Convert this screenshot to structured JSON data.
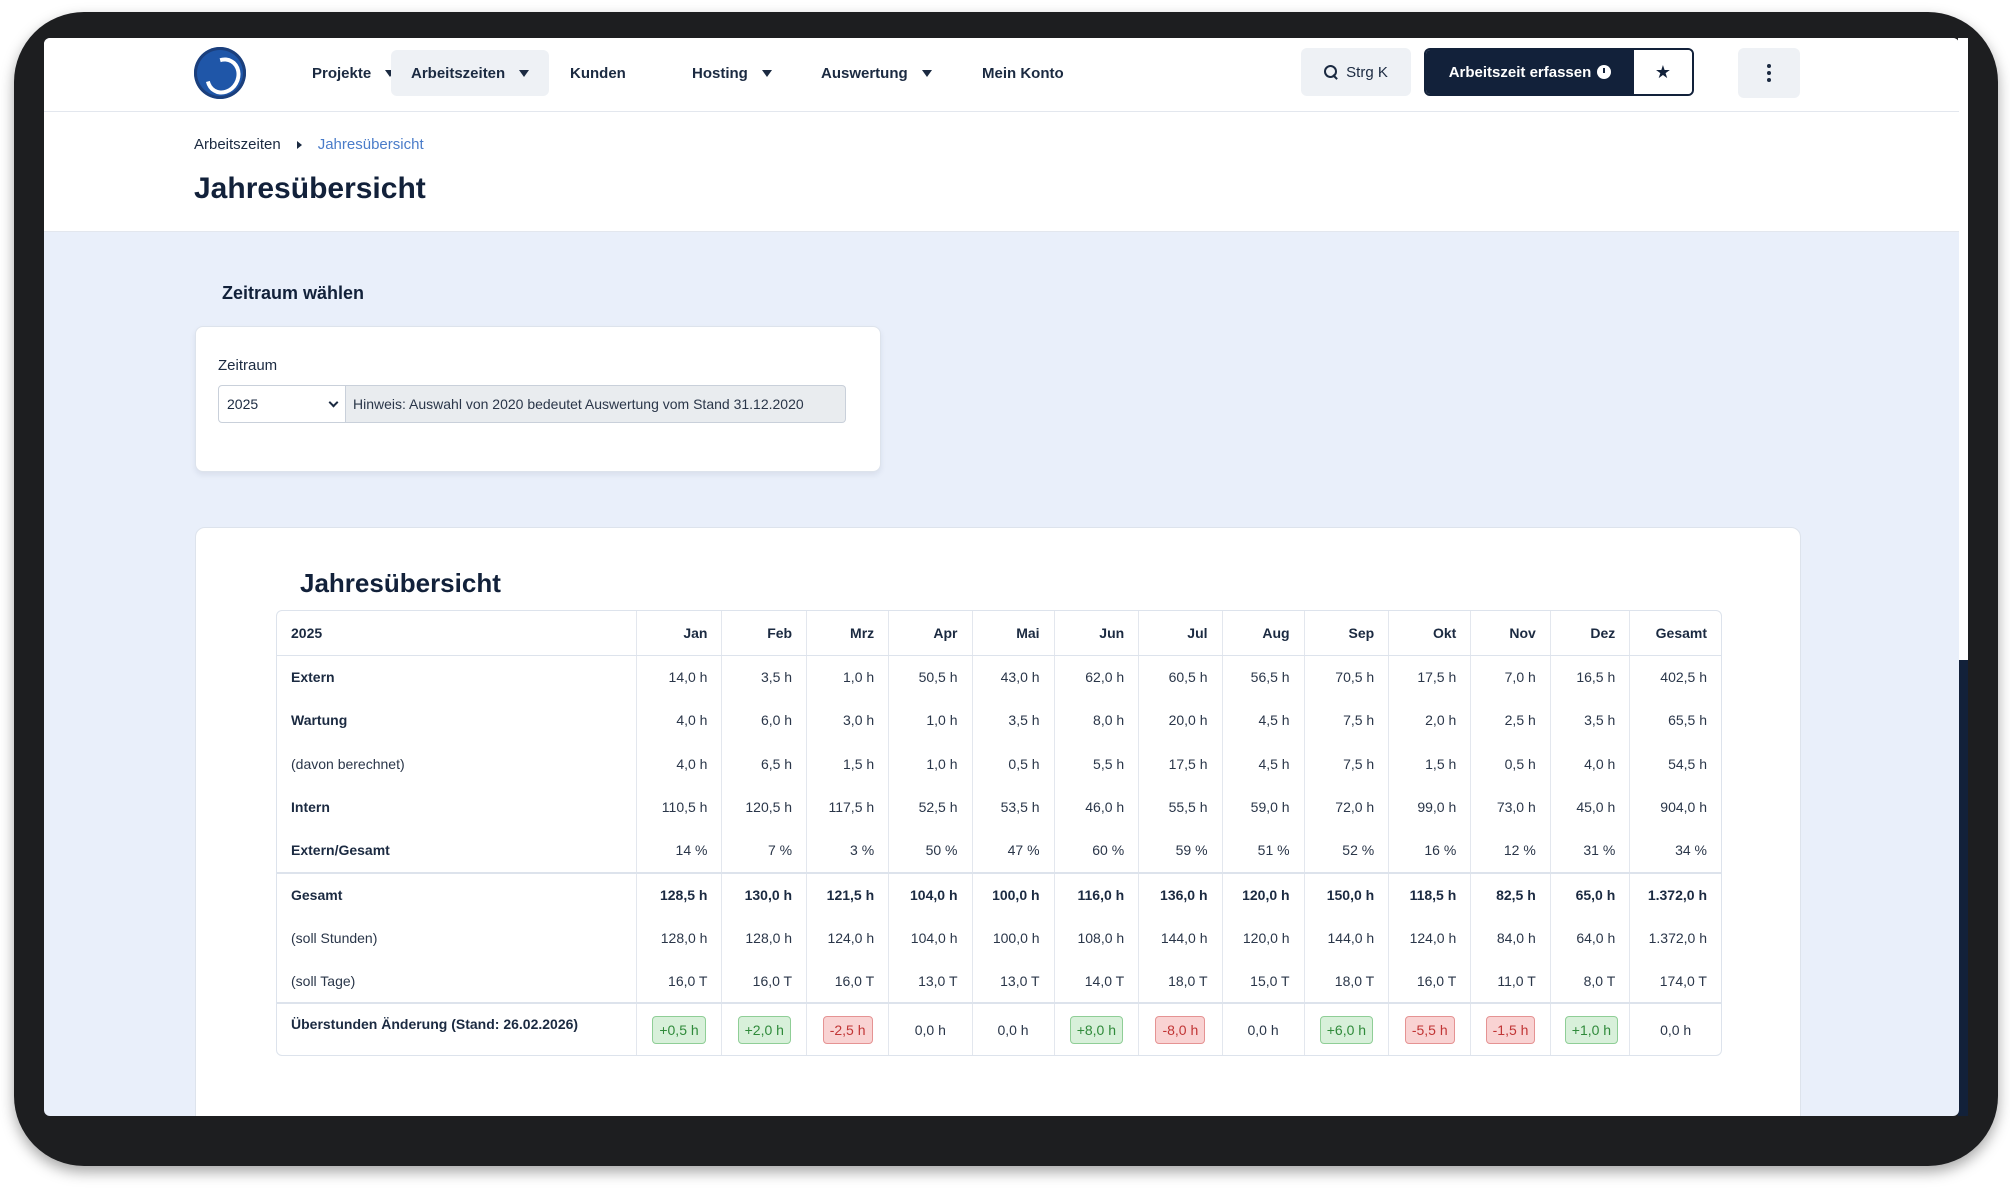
{
  "nav": {
    "items": [
      {
        "label": "Projekte",
        "has_caret": true
      },
      {
        "label": "Arbeitszeiten",
        "has_caret": true,
        "active": true
      },
      {
        "label": "Kunden",
        "has_caret": false
      },
      {
        "label": "Hosting",
        "has_caret": true
      },
      {
        "label": "Auswertung",
        "has_caret": true
      },
      {
        "label": "Mein Konto",
        "has_caret": false
      }
    ],
    "search_label": "Strg K",
    "primary_button": "Arbeitszeit erfassen",
    "colors": {
      "primary": "#12213a",
      "accent_link": "#4a7cc9",
      "page_bg": "#e9effa"
    }
  },
  "breadcrumb": {
    "parent": "Arbeitszeiten",
    "current": "Jahresübersicht"
  },
  "page_title": "Jahresübersicht",
  "filter": {
    "section_title": "Zeitraum wählen",
    "field_label": "Zeitraum",
    "selected_year": "2025",
    "hint": "Hinweis: Auswahl von 2020 bedeutet Auswertung vom Stand 31.12.2020"
  },
  "overview": {
    "title": "Jahresübersicht",
    "headers": [
      "2025",
      "Jan",
      "Feb",
      "Mrz",
      "Apr",
      "Mai",
      "Jun",
      "Jul",
      "Aug",
      "Sep",
      "Okt",
      "Nov",
      "Dez",
      "Gesamt"
    ],
    "rows": [
      {
        "label": "Extern",
        "style": "label-bold",
        "values": [
          "14,0 h",
          "3,5 h",
          "1,0 h",
          "50,5 h",
          "43,0 h",
          "62,0 h",
          "60,5 h",
          "56,5 h",
          "70,5 h",
          "17,5 h",
          "7,0 h",
          "16,5 h",
          "402,5 h"
        ]
      },
      {
        "label": "Wartung",
        "style": "label-bold",
        "values": [
          "4,0 h",
          "6,0 h",
          "3,0 h",
          "1,0 h",
          "3,5 h",
          "8,0 h",
          "20,0 h",
          "4,5 h",
          "7,5 h",
          "2,0 h",
          "2,5 h",
          "3,5 h",
          "65,5 h"
        ]
      },
      {
        "label": "(davon berechnet)",
        "style": "plain",
        "values": [
          "4,0 h",
          "6,5 h",
          "1,5 h",
          "1,0 h",
          "0,5 h",
          "5,5 h",
          "17,5 h",
          "4,5 h",
          "7,5 h",
          "1,5 h",
          "0,5 h",
          "4,0 h",
          "54,5 h"
        ]
      },
      {
        "label": "Intern",
        "style": "label-bold",
        "values": [
          "110,5 h",
          "120,5 h",
          "117,5 h",
          "52,5 h",
          "53,5 h",
          "46,0 h",
          "55,5 h",
          "59,0 h",
          "72,0 h",
          "99,0 h",
          "73,0 h",
          "45,0 h",
          "904,0 h"
        ]
      },
      {
        "label": "Extern/Gesamt",
        "style": "label-bold",
        "values": [
          "14 %",
          "7 %",
          "3 %",
          "50 %",
          "47 %",
          "60 %",
          "59 %",
          "51 %",
          "52 %",
          "16 %",
          "12 %",
          "31 %",
          "34 %"
        ]
      },
      {
        "label": "Gesamt",
        "style": "bold sep-top",
        "values": [
          "128,5 h",
          "130,0 h",
          "121,5 h",
          "104,0 h",
          "100,0 h",
          "116,0 h",
          "136,0 h",
          "120,0 h",
          "150,0 h",
          "118,5 h",
          "82,5 h",
          "65,0 h",
          "1.372,0 h"
        ]
      },
      {
        "label": "(soll Stunden)",
        "style": "plain",
        "values": [
          "128,0 h",
          "128,0 h",
          "124,0 h",
          "104,0 h",
          "100,0 h",
          "108,0 h",
          "144,0 h",
          "120,0 h",
          "144,0 h",
          "124,0 h",
          "84,0 h",
          "64,0 h",
          "1.372,0 h"
        ]
      },
      {
        "label": "(soll Tage)",
        "style": "plain",
        "values": [
          "16,0 T",
          "16,0 T",
          "16,0 T",
          "13,0 T",
          "13,0 T",
          "14,0 T",
          "18,0 T",
          "15,0 T",
          "18,0 T",
          "16,0 T",
          "11,0 T",
          "8,0 T",
          "174,0 T"
        ]
      }
    ],
    "overtime": {
      "label": "Überstunden Änderung (Stand: 26.02.2026)",
      "values": [
        {
          "text": "+0,5 h",
          "kind": "pos"
        },
        {
          "text": "+2,0 h",
          "kind": "pos"
        },
        {
          "text": "-2,5 h",
          "kind": "neg"
        },
        {
          "text": "0,0 h",
          "kind": "zero"
        },
        {
          "text": "0,0 h",
          "kind": "zero"
        },
        {
          "text": "+8,0 h",
          "kind": "pos"
        },
        {
          "text": "-8,0 h",
          "kind": "neg"
        },
        {
          "text": "0,0 h",
          "kind": "zero"
        },
        {
          "text": "+6,0 h",
          "kind": "pos"
        },
        {
          "text": "-5,5 h",
          "kind": "neg"
        },
        {
          "text": "-1,5 h",
          "kind": "neg"
        },
        {
          "text": "+1,0 h",
          "kind": "pos"
        },
        {
          "text": "0,0 h",
          "kind": "zero"
        }
      ]
    }
  }
}
